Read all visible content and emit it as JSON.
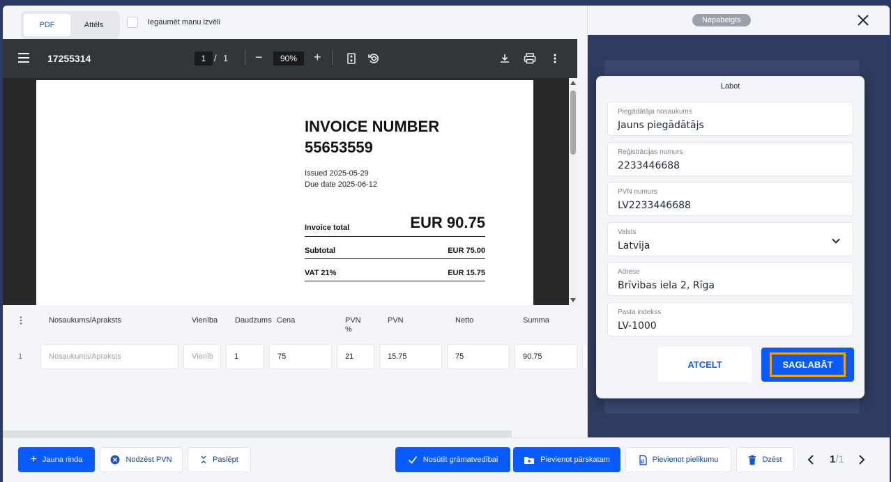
{
  "top": {
    "tabs": [
      {
        "label": "PDF"
      },
      {
        "label": "Attēls"
      }
    ],
    "remember_label": "Iegaumēt manu izvēli"
  },
  "pdf_viewer": {
    "doc_title": "17255314",
    "page_current": "1",
    "page_separator": "/",
    "page_total": "1",
    "zoom": "90%"
  },
  "invoice": {
    "title_line1": "INVOICE NUMBER",
    "title_line2": "55653559",
    "issued": "Issued 2025-05-29",
    "due": "Due date 2025-06-12",
    "rows": [
      {
        "label": "Invoice total",
        "value": "EUR 90.75"
      },
      {
        "label": "Subtotal",
        "value": "EUR 75.00"
      },
      {
        "label": "VAT 21%",
        "value": "EUR 15.75"
      }
    ]
  },
  "lines_table": {
    "columns": [
      "Nosaukums/Apraksts",
      "Vienība",
      "Daudzums",
      "Cena",
      "PVN %",
      "PVN",
      "Netto",
      "Summa"
    ],
    "row": {
      "index": "1",
      "description_placeholder": "Nosaukums/Apraksts",
      "unit_placeholder": "Vienīb",
      "quantity": "1",
      "price": "75",
      "vat_percent": "21",
      "vat": "15.75",
      "net": "75",
      "total": "90.75"
    }
  },
  "footer": {
    "new_row": "Jauna rinda",
    "delete_vat": "Nodzēst PVN",
    "hide": "Paslēpt",
    "send": "Nosūtīt grāmatvedībai",
    "add_report": "Pievienot pārskatam",
    "add_attachment": "Pievienot pielikumu",
    "delete": "Dzēst",
    "pager_current": "1",
    "pager_total": "/1"
  },
  "right_panel": {
    "status": "Nepabeigts"
  },
  "edit_dialog": {
    "title": "Labot",
    "fields": [
      {
        "label": "Piegādātāja nosaukums",
        "value": "Jauns piegādātājs"
      },
      {
        "label": "Reģistrācijas numurs",
        "value": "2233446688"
      },
      {
        "label": "PVN numurs",
        "value": "LV2233446688"
      },
      {
        "label": "Valsts",
        "value": "Latvija"
      },
      {
        "label": "Adrese",
        "value": "Brīvibas iela 2, Rīga"
      },
      {
        "label": "Pasta indekss",
        "value": "LV-1000"
      }
    ],
    "cancel": "ATCELT",
    "save": "SAGLABĀT"
  },
  "colors": {
    "primary": "#0a5bff",
    "focus_outline": "#f5a300",
    "status_badge": "#9aa1ac"
  }
}
